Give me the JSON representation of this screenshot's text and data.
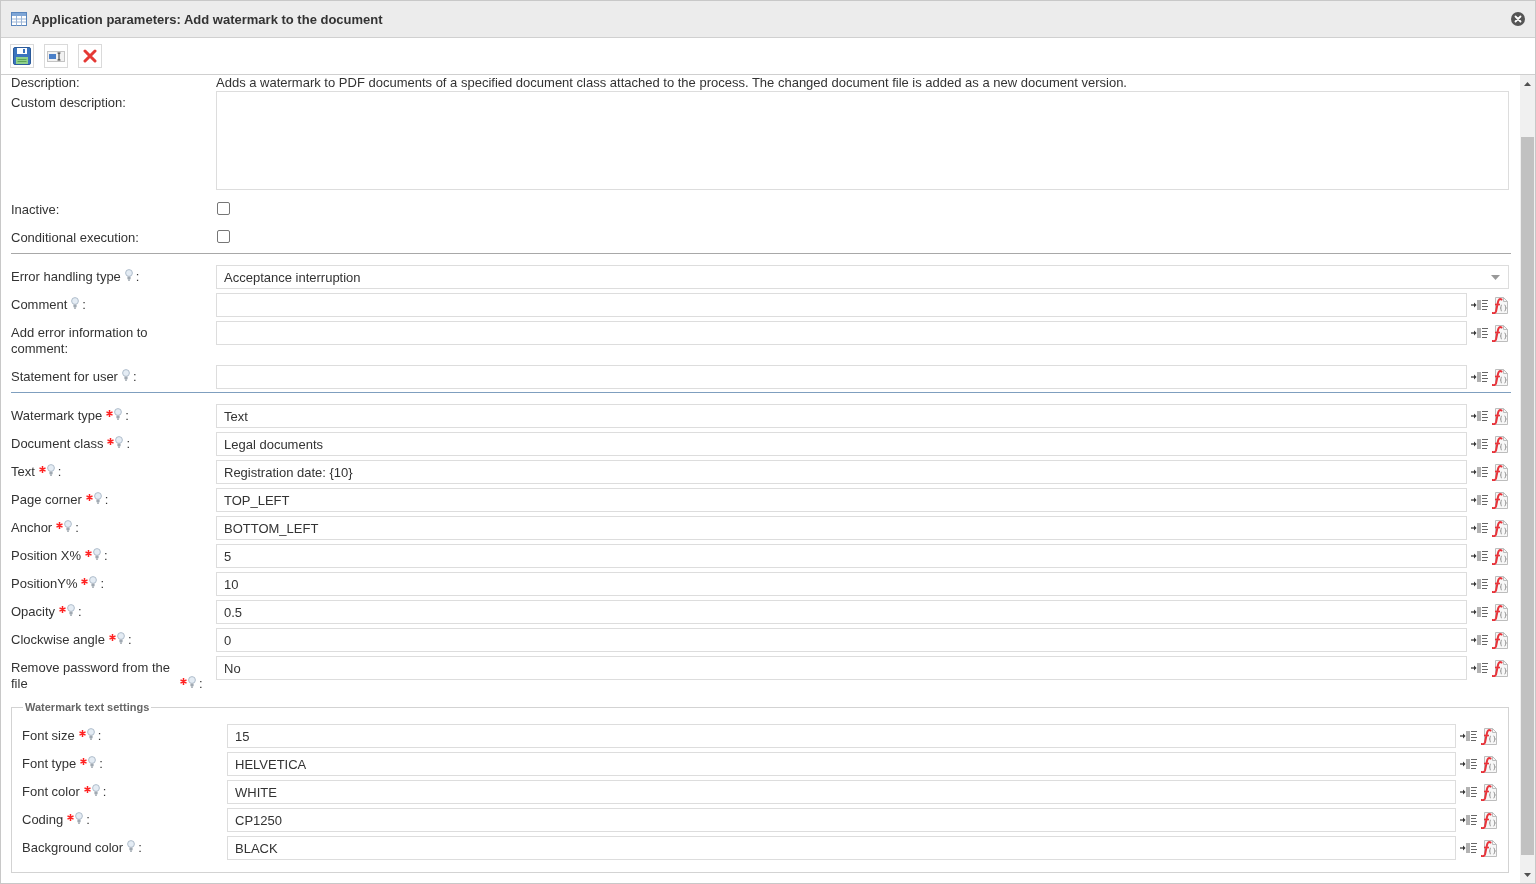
{
  "window": {
    "title": "Application parameters: Add watermark to the document"
  },
  "sections": [
    {
      "rows": [
        {
          "kind": "static",
          "label": "Description:",
          "required": false,
          "hint": false,
          "value": "Adds a watermark to PDF documents of a specified document class attached to the process. The changed document file is added as a new document version."
        },
        {
          "kind": "textarea",
          "label": "Custom description:",
          "required": false,
          "hint": false
        },
        {
          "kind": "checkbox",
          "label": "Inactive:",
          "required": false,
          "hint": false,
          "checked": false
        },
        {
          "kind": "checkbox",
          "label": "Conditional execution:",
          "required": false,
          "hint": false,
          "checked": false
        }
      ]
    },
    {
      "rows": [
        {
          "kind": "select",
          "label": "Error handling type",
          "required": false,
          "hint": true,
          "colon": ":",
          "value": "Acceptance interruption"
        },
        {
          "kind": "input",
          "label": "Comment",
          "required": false,
          "hint": true,
          "colon": ":"
        },
        {
          "kind": "input",
          "label": "Add error information to comment:",
          "required": false,
          "hint": false
        },
        {
          "kind": "input",
          "label": "Statement for user",
          "required": false,
          "hint": true,
          "colon": ":"
        }
      ]
    },
    {
      "rows": [
        {
          "kind": "input",
          "label": "Watermark type",
          "required": true,
          "hint": true,
          "colon": ":",
          "value": "Text"
        },
        {
          "kind": "input",
          "label": "Document class",
          "required": true,
          "hint": true,
          "colon": ":",
          "value": "Legal documents"
        },
        {
          "kind": "input",
          "label": "Text",
          "required": true,
          "hint": true,
          "colon": ":",
          "value": "Registration date: {10}"
        },
        {
          "kind": "input",
          "label": "Page corner",
          "required": true,
          "hint": true,
          "colon": ":",
          "value": "TOP_LEFT"
        },
        {
          "kind": "input",
          "label": "Anchor",
          "required": true,
          "hint": true,
          "colon": ":",
          "value": "BOTTOM_LEFT"
        },
        {
          "kind": "input",
          "label": "Position X%",
          "required": true,
          "hint": true,
          "colon": ":",
          "value": "5"
        },
        {
          "kind": "input",
          "label": "PositionY%",
          "required": true,
          "hint": true,
          "colon": ":",
          "value": "10"
        },
        {
          "kind": "input",
          "label": "Opacity",
          "required": true,
          "hint": true,
          "colon": ":",
          "value": "0.5"
        },
        {
          "kind": "input",
          "label": "Clockwise angle",
          "required": true,
          "hint": true,
          "colon": ":",
          "value": "0"
        },
        {
          "kind": "input",
          "label": "Remove password from the file",
          "required": true,
          "hint": true,
          "colon": ":",
          "value": "No"
        }
      ]
    }
  ],
  "fieldset": {
    "legend": "Watermark text settings",
    "rows": [
      {
        "kind": "input",
        "label": "Font size",
        "required": true,
        "hint": true,
        "colon": ":",
        "value": "15"
      },
      {
        "kind": "input",
        "label": "Font type",
        "required": true,
        "hint": true,
        "colon": ":",
        "value": "HELVETICA"
      },
      {
        "kind": "input",
        "label": "Font color",
        "required": true,
        "hint": true,
        "colon": ":",
        "value": "WHITE"
      },
      {
        "kind": "input",
        "label": "Coding",
        "required": true,
        "hint": true,
        "colon": ":",
        "value": "CP1250"
      },
      {
        "kind": "input",
        "label": "Background color",
        "required": false,
        "hint": true,
        "colon": ":",
        "value": "BLACK"
      }
    ]
  }
}
